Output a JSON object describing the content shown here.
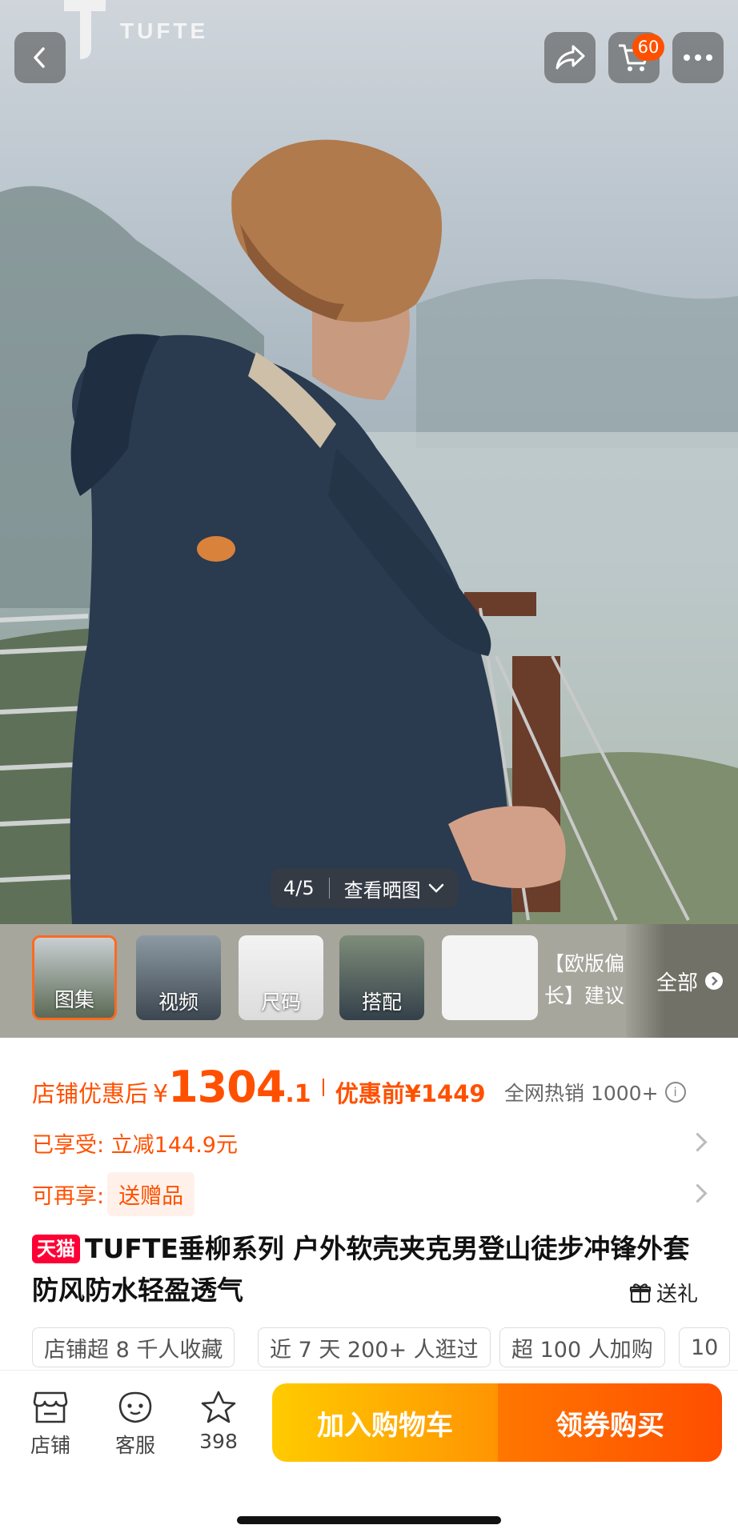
{
  "brand": {
    "name": "TUFTE"
  },
  "header": {
    "cart_count": "60"
  },
  "gallery": {
    "page_indicator": "4/5",
    "view_photos_label": "查看晒图",
    "thumbnails": [
      {
        "label": "图集"
      },
      {
        "label": "视频"
      },
      {
        "label": "尺码"
      },
      {
        "label": "搭配"
      },
      {
        "label": "【欧版偏长】建议"
      }
    ],
    "all_label": "全部"
  },
  "price": {
    "after_label": "店铺优惠后",
    "currency": "¥",
    "amount_int": "1304",
    "amount_dec": ".1",
    "before_label": "优惠前",
    "before_value": "¥1449",
    "sales": "全网热销 1000+"
  },
  "discount": {
    "enjoyed": "已享受: 立减144.9元",
    "more_label": "可再享:",
    "gift_tag": "送赠品"
  },
  "product": {
    "badge": "天猫",
    "title": "TUFTE垂柳系列 户外软壳夹克男登山徒步冲锋外套防风防水轻盈透气",
    "gift_button": "送礼"
  },
  "tags": [
    "店铺超 8 千人收藏",
    "近 7 天 200+ 人逛过",
    "超 100 人加购",
    "10"
  ],
  "bottom_bar": {
    "shop": "店铺",
    "service": "客服",
    "favorites": "398",
    "add_to_cart": "加入购物车",
    "buy_with_coupon": "领券购买"
  },
  "colors": {
    "accent": "#ff5000",
    "tmall": "#ff0036",
    "cart_gradient_start": "#ffcb00",
    "buy_gradient_end": "#ff4e00"
  }
}
